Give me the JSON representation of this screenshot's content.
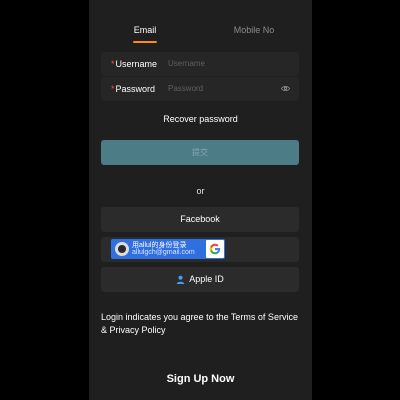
{
  "tabs": {
    "email": "Email",
    "mobile": "Mobile No"
  },
  "form": {
    "required_mark": "*",
    "username_label": "Username",
    "username_placeholder": "Username",
    "password_label": "Password",
    "password_placeholder": "Password",
    "password_toggle_icon": "eye-icon"
  },
  "recover": "Recover password",
  "submit_label": "提交",
  "or_text": "or",
  "social": {
    "facebook_label": "Facebook",
    "google_line1": "用allul的身份登录",
    "google_line2": "allulgch@gmail.com",
    "google_icon": "google-g-icon",
    "apple_icon": "person-icon",
    "apple_label": "Apple ID"
  },
  "terms_text": "Login indicates you agree to the Terms of Service & Privacy Policy",
  "signup": "Sign Up Now",
  "colors": {
    "accent": "#ff8a1c",
    "required": "#ff4d4f",
    "submit_bg": "#4c7d86",
    "google_blue": "#2f6fe0"
  }
}
